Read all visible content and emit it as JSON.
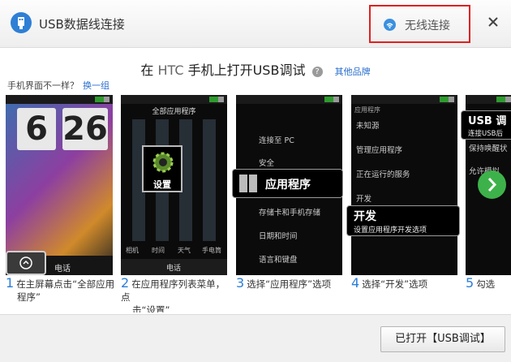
{
  "app": {
    "title": "USB数据线连接"
  },
  "wireless": {
    "label": "无线连接"
  },
  "heading": {
    "prefix": "在",
    "brand": "HTC",
    "suffix": "手机上打开USB调试",
    "help": "?",
    "other_brands": "其他品牌"
  },
  "notice": {
    "text": "手机界面不一样？",
    "switch_link": "换一组"
  },
  "phones": {
    "p1": {
      "hour": "6",
      "minute": "26",
      "app1": "电话"
    },
    "p2": {
      "title": "全部应用程序",
      "callout": "设置",
      "row": [
        "相机",
        "时间",
        "天气",
        "手电筒"
      ],
      "bottom": "电话"
    },
    "p3": {
      "items": [
        "连接至 PC",
        "安全",
        "应用程序",
        "存储卡和手机存储",
        "日期和时间",
        "语言和键盘"
      ]
    },
    "p4": {
      "title": "应用程序",
      "items": [
        "未知源",
        "管理应用程序",
        "正在运行的服务",
        "开发"
      ],
      "callout_title": "开发",
      "callout_sub": "设置应用程序开发选项"
    },
    "p5": {
      "callout_title": "USB 调",
      "callout_sub": "连接USB后",
      "items": [
        "保持唤醒状",
        "允许模拟"
      ]
    }
  },
  "steps": [
    {
      "num": "1",
      "line1": "在主屏幕点击“全部应用",
      "line2": "程序”"
    },
    {
      "num": "2",
      "line1": "在应用程序列表菜单，点",
      "line2": "击“设置”"
    },
    {
      "num": "3",
      "line1": "选择“应用程序”选项",
      "line2": ""
    },
    {
      "num": "4",
      "line1": "选择“开发”选项",
      "line2": ""
    },
    {
      "num": "5",
      "line1": "勾选",
      "line2": ""
    }
  ],
  "footer": {
    "button": "已打开【USB调试】"
  },
  "colors": {
    "accent": "#2a7ed8",
    "highlight_border": "#e02020",
    "next_button": "#3eb24a"
  },
  "icons": [
    "usb-icon",
    "wifi-icon",
    "close-icon",
    "help-icon",
    "chevron-right-icon",
    "gear-icon"
  ]
}
